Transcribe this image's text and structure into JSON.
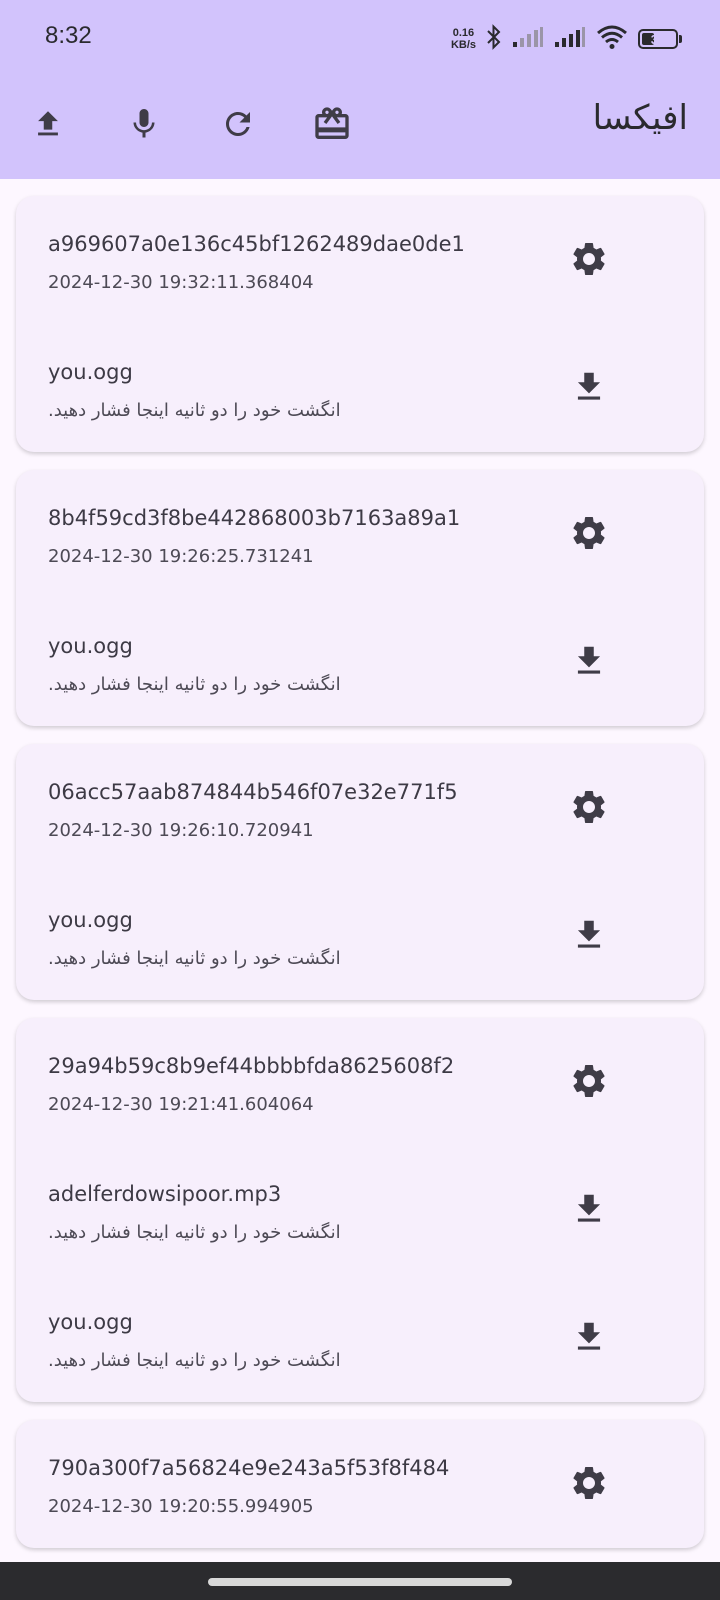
{
  "status_bar": {
    "time": "8:32",
    "net_speed_value": "0.16",
    "net_speed_unit": "KB/s",
    "battery": "38",
    "battery_level": 0.38
  },
  "app_bar": {
    "title": "افیکسا",
    "actions": [
      {
        "icon": "upload-icon"
      },
      {
        "icon": "microphone-icon"
      },
      {
        "icon": "refresh-icon"
      },
      {
        "icon": "gift-icon"
      }
    ]
  },
  "colors": {
    "app_bar_bg": "#d2c3fc",
    "page_bg": "#fdf7ff",
    "card_bg": "#f7effc",
    "icon": "#3f3c47"
  },
  "jobs": [
    {
      "id": "a969607a0e136c45bf1262489dae0de1",
      "timestamp": "2024-12-30 19:32:11.368404",
      "files": [
        {
          "name": "you.ogg",
          "hint": "انگشت خود را دو ثانیه اینجا فشار دهید."
        }
      ]
    },
    {
      "id": "8b4f59cd3f8be442868003b7163a89a1",
      "timestamp": "2024-12-30 19:26:25.731241",
      "files": [
        {
          "name": "you.ogg",
          "hint": "انگشت خود را دو ثانیه اینجا فشار دهید."
        }
      ]
    },
    {
      "id": "06acc57aab874844b546f07e32e771f5",
      "timestamp": "2024-12-30 19:26:10.720941",
      "files": [
        {
          "name": "you.ogg",
          "hint": "انگشت خود را دو ثانیه اینجا فشار دهید."
        }
      ]
    },
    {
      "id": "29a94b59c8b9ef44bbbbfda8625608f2",
      "timestamp": "2024-12-30 19:21:41.604064",
      "files": [
        {
          "name": "adelferdowsipoor.mp3",
          "hint": "انگشت خود را دو ثانیه اینجا فشار دهید."
        },
        {
          "name": "you.ogg",
          "hint": "انگشت خود را دو ثانیه اینجا فشار دهید."
        }
      ]
    },
    {
      "id": "790a300f7a56824e9e243a5f53f8f484",
      "timestamp": "2024-12-30 19:20:55.994905",
      "files": []
    }
  ]
}
